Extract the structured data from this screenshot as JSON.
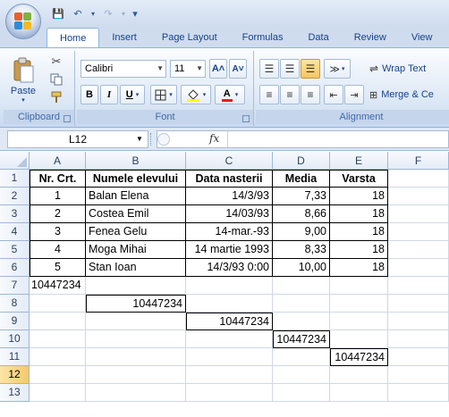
{
  "qat": {
    "save": "💾",
    "undo": "↶",
    "redo": "↷",
    "customize": "▾"
  },
  "tabs": [
    "Home",
    "Insert",
    "Page Layout",
    "Formulas",
    "Data",
    "Review",
    "View"
  ],
  "ribbon": {
    "clipboard": {
      "label": "Clipboard",
      "paste": "Paste"
    },
    "font": {
      "label": "Font",
      "name": "Calibri",
      "size": "11",
      "bold": "B",
      "italic": "I",
      "underline": "U",
      "grow": "A˄",
      "shrink": "A˅"
    },
    "alignment": {
      "label": "Alignment",
      "wrap": "Wrap Text",
      "merge": "Merge & Ce"
    }
  },
  "formula_bar": {
    "name_box": "L12",
    "fx": "fx",
    "formula": ""
  },
  "sheet": {
    "columns": [
      "A",
      "B",
      "C",
      "D",
      "E",
      "F"
    ],
    "rows": [
      "1",
      "2",
      "3",
      "4",
      "5",
      "6",
      "7",
      "8",
      "9",
      "10",
      "11",
      "12",
      "13"
    ],
    "headers": [
      "Nr. Crt.",
      "Numele elevului",
      "Data nasterii",
      "Media",
      "Varsta"
    ],
    "records": [
      [
        "1",
        "Balan Elena",
        "14/3/93",
        "7,33",
        "18"
      ],
      [
        "2",
        "Costea Emil",
        "14/03/93",
        "8,66",
        "18"
      ],
      [
        "3",
        "Fenea Gelu",
        "14-mar.-93",
        "9,00",
        "18"
      ],
      [
        "4",
        "Moga Mihai",
        "14 martie 1993",
        "8,33",
        "18"
      ],
      [
        "5",
        "Stan Ioan",
        "14/3/93 0:00",
        "10,00",
        "18"
      ]
    ],
    "diagonal_values": [
      "10447234",
      "10447234",
      "10447234",
      "10447234",
      "10447234"
    ]
  },
  "colors": {
    "accent": "#15428b",
    "ribbon_bg": "#dbe7f5",
    "grid": "#d0d7e5",
    "header_bg": "#e4ecf7"
  }
}
